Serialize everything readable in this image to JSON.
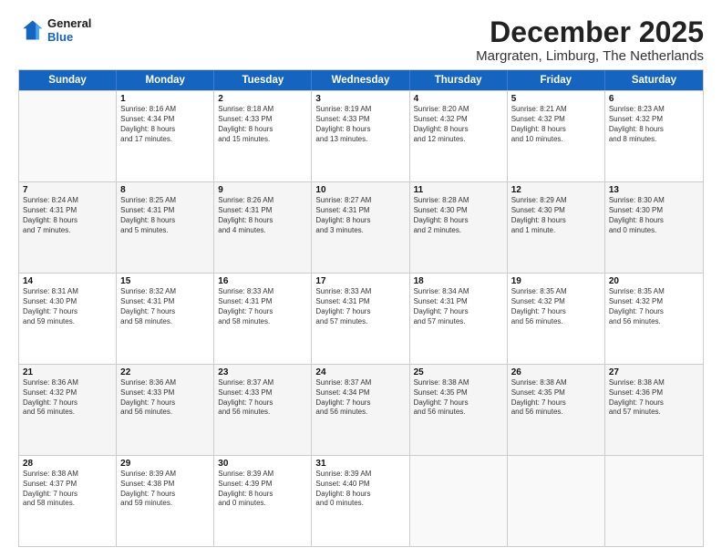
{
  "logo": {
    "line1": "General",
    "line2": "Blue"
  },
  "title": "December 2025",
  "location": "Margraten, Limburg, The Netherlands",
  "header_days": [
    "Sunday",
    "Monday",
    "Tuesday",
    "Wednesday",
    "Thursday",
    "Friday",
    "Saturday"
  ],
  "rows": [
    [
      {
        "date": "",
        "info": ""
      },
      {
        "date": "1",
        "info": "Sunrise: 8:16 AM\nSunset: 4:34 PM\nDaylight: 8 hours\nand 17 minutes."
      },
      {
        "date": "2",
        "info": "Sunrise: 8:18 AM\nSunset: 4:33 PM\nDaylight: 8 hours\nand 15 minutes."
      },
      {
        "date": "3",
        "info": "Sunrise: 8:19 AM\nSunset: 4:33 PM\nDaylight: 8 hours\nand 13 minutes."
      },
      {
        "date": "4",
        "info": "Sunrise: 8:20 AM\nSunset: 4:32 PM\nDaylight: 8 hours\nand 12 minutes."
      },
      {
        "date": "5",
        "info": "Sunrise: 8:21 AM\nSunset: 4:32 PM\nDaylight: 8 hours\nand 10 minutes."
      },
      {
        "date": "6",
        "info": "Sunrise: 8:23 AM\nSunset: 4:32 PM\nDaylight: 8 hours\nand 8 minutes."
      }
    ],
    [
      {
        "date": "7",
        "info": "Sunrise: 8:24 AM\nSunset: 4:31 PM\nDaylight: 8 hours\nand 7 minutes."
      },
      {
        "date": "8",
        "info": "Sunrise: 8:25 AM\nSunset: 4:31 PM\nDaylight: 8 hours\nand 5 minutes."
      },
      {
        "date": "9",
        "info": "Sunrise: 8:26 AM\nSunset: 4:31 PM\nDaylight: 8 hours\nand 4 minutes."
      },
      {
        "date": "10",
        "info": "Sunrise: 8:27 AM\nSunset: 4:31 PM\nDaylight: 8 hours\nand 3 minutes."
      },
      {
        "date": "11",
        "info": "Sunrise: 8:28 AM\nSunset: 4:30 PM\nDaylight: 8 hours\nand 2 minutes."
      },
      {
        "date": "12",
        "info": "Sunrise: 8:29 AM\nSunset: 4:30 PM\nDaylight: 8 hours\nand 1 minute."
      },
      {
        "date": "13",
        "info": "Sunrise: 8:30 AM\nSunset: 4:30 PM\nDaylight: 8 hours\nand 0 minutes."
      }
    ],
    [
      {
        "date": "14",
        "info": "Sunrise: 8:31 AM\nSunset: 4:30 PM\nDaylight: 7 hours\nand 59 minutes."
      },
      {
        "date": "15",
        "info": "Sunrise: 8:32 AM\nSunset: 4:31 PM\nDaylight: 7 hours\nand 58 minutes."
      },
      {
        "date": "16",
        "info": "Sunrise: 8:33 AM\nSunset: 4:31 PM\nDaylight: 7 hours\nand 58 minutes."
      },
      {
        "date": "17",
        "info": "Sunrise: 8:33 AM\nSunset: 4:31 PM\nDaylight: 7 hours\nand 57 minutes."
      },
      {
        "date": "18",
        "info": "Sunrise: 8:34 AM\nSunset: 4:31 PM\nDaylight: 7 hours\nand 57 minutes."
      },
      {
        "date": "19",
        "info": "Sunrise: 8:35 AM\nSunset: 4:32 PM\nDaylight: 7 hours\nand 56 minutes."
      },
      {
        "date": "20",
        "info": "Sunrise: 8:35 AM\nSunset: 4:32 PM\nDaylight: 7 hours\nand 56 minutes."
      }
    ],
    [
      {
        "date": "21",
        "info": "Sunrise: 8:36 AM\nSunset: 4:32 PM\nDaylight: 7 hours\nand 56 minutes."
      },
      {
        "date": "22",
        "info": "Sunrise: 8:36 AM\nSunset: 4:33 PM\nDaylight: 7 hours\nand 56 minutes."
      },
      {
        "date": "23",
        "info": "Sunrise: 8:37 AM\nSunset: 4:33 PM\nDaylight: 7 hours\nand 56 minutes."
      },
      {
        "date": "24",
        "info": "Sunrise: 8:37 AM\nSunset: 4:34 PM\nDaylight: 7 hours\nand 56 minutes."
      },
      {
        "date": "25",
        "info": "Sunrise: 8:38 AM\nSunset: 4:35 PM\nDaylight: 7 hours\nand 56 minutes."
      },
      {
        "date": "26",
        "info": "Sunrise: 8:38 AM\nSunset: 4:35 PM\nDaylight: 7 hours\nand 56 minutes."
      },
      {
        "date": "27",
        "info": "Sunrise: 8:38 AM\nSunset: 4:36 PM\nDaylight: 7 hours\nand 57 minutes."
      }
    ],
    [
      {
        "date": "28",
        "info": "Sunrise: 8:38 AM\nSunset: 4:37 PM\nDaylight: 7 hours\nand 58 minutes."
      },
      {
        "date": "29",
        "info": "Sunrise: 8:39 AM\nSunset: 4:38 PM\nDaylight: 7 hours\nand 59 minutes."
      },
      {
        "date": "30",
        "info": "Sunrise: 8:39 AM\nSunset: 4:39 PM\nDaylight: 8 hours\nand 0 minutes."
      },
      {
        "date": "31",
        "info": "Sunrise: 8:39 AM\nSunset: 4:40 PM\nDaylight: 8 hours\nand 0 minutes."
      },
      {
        "date": "",
        "info": ""
      },
      {
        "date": "",
        "info": ""
      },
      {
        "date": "",
        "info": ""
      }
    ]
  ]
}
